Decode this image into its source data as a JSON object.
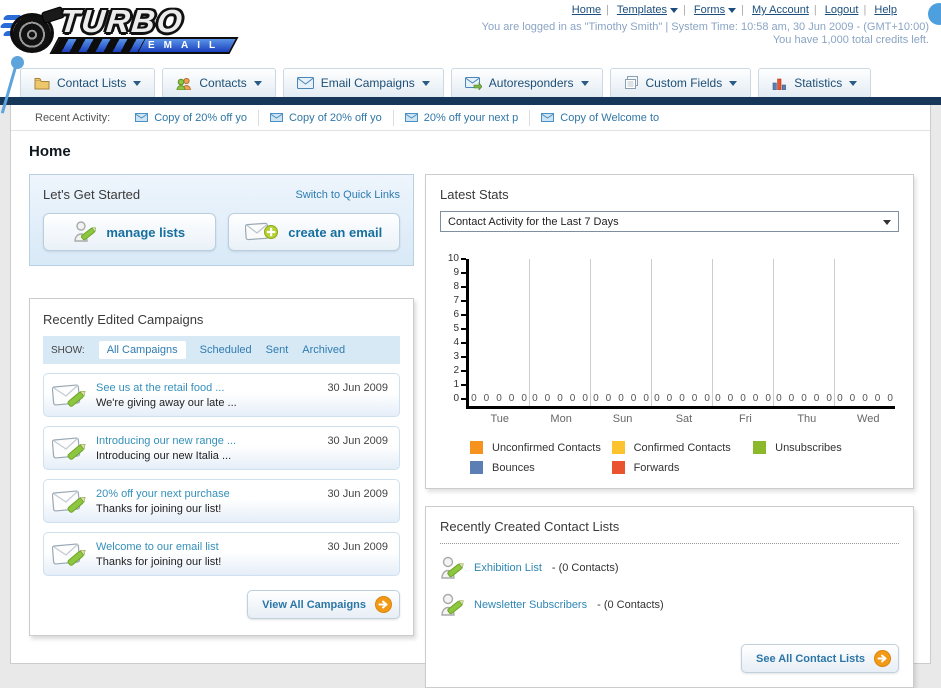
{
  "header": {
    "logo_line1": "TURBO",
    "logo_line2": "EMAIL",
    "nav": {
      "home": "Home",
      "templates": "Templates",
      "forms": "Forms",
      "my_account": "My Account",
      "logout": "Logout",
      "help": "Help"
    },
    "login_info": "You are logged in as \"Timothy Smith\" | System Time: 10:58 am, 30 Jun 2009 - (GMT+10:00)",
    "credits_info": "You have 1,000 total credits left."
  },
  "tabs": [
    {
      "label": "Contact Lists"
    },
    {
      "label": "Contacts"
    },
    {
      "label": "Email Campaigns"
    },
    {
      "label": "Autoresponders"
    },
    {
      "label": "Custom Fields"
    },
    {
      "label": "Statistics"
    }
  ],
  "recent_activity": {
    "label": "Recent Activity:",
    "items": [
      {
        "text": "Copy of 20% off yo"
      },
      {
        "text": "Copy of 20% off yo"
      },
      {
        "text": "20% off your next p"
      },
      {
        "text": "Copy of Welcome to"
      }
    ]
  },
  "home_title": "Home",
  "get_started": {
    "title": "Let's Get Started",
    "switch_link": "Switch to Quick Links",
    "manage_lists_label": "manage lists",
    "create_email_label": "create an email"
  },
  "campaigns_panel": {
    "title": "Recently Edited Campaigns",
    "show_label": "SHOW:",
    "filters": [
      {
        "label": "All Campaigns"
      },
      {
        "label": "Scheduled"
      },
      {
        "label": "Sent"
      },
      {
        "label": "Archived"
      }
    ],
    "items": [
      {
        "title": "See us at the retail food ...",
        "subtitle": "We're giving away our late ...",
        "date": "30 Jun 2009"
      },
      {
        "title": "Introducing our new range ...",
        "subtitle": "Introducing our new Italia ...",
        "date": "30 Jun 2009"
      },
      {
        "title": "20% off your next purchase",
        "subtitle": "Thanks for joining our list!",
        "date": "30 Jun 2009"
      },
      {
        "title": "Welcome to our email list",
        "subtitle": "Thanks for joining our list!",
        "date": "30 Jun 2009"
      }
    ],
    "view_all_label": "View All Campaigns"
  },
  "stats_panel": {
    "title": "Latest Stats",
    "dropdown_value": "Contact Activity for the Last 7 Days"
  },
  "chart_data": {
    "type": "bar",
    "categories": [
      "Tue",
      "Mon",
      "Sun",
      "Sat",
      "Fri",
      "Thu",
      "Wed"
    ],
    "series": [
      {
        "name": "Unconfirmed Contacts",
        "color": "#f6921e",
        "values": [
          0,
          0,
          0,
          0,
          0,
          0,
          0
        ]
      },
      {
        "name": "Confirmed Contacts",
        "color": "#fdc32f",
        "values": [
          0,
          0,
          0,
          0,
          0,
          0,
          0
        ]
      },
      {
        "name": "Unsubscribes",
        "color": "#8cb82b",
        "values": [
          0,
          0,
          0,
          0,
          0,
          0,
          0
        ]
      },
      {
        "name": "Bounces",
        "color": "#5b7fb4",
        "values": [
          0,
          0,
          0,
          0,
          0,
          0,
          0
        ]
      },
      {
        "name": "Forwards",
        "color": "#e9532d",
        "values": [
          0,
          0,
          0,
          0,
          0,
          0,
          0
        ]
      }
    ],
    "ylim": [
      0,
      10
    ],
    "yticks": [
      10,
      9,
      8,
      7,
      6,
      5,
      4,
      3,
      2,
      1,
      0
    ],
    "grid": "vertical",
    "legend_position": "bottom",
    "value_labels_shown": true
  },
  "contact_lists_panel": {
    "title": "Recently Created Contact Lists",
    "items": [
      {
        "name": "Exhibition List",
        "count": "- (0 Contacts)"
      },
      {
        "name": "Newsletter Subscribers",
        "count": "- (0 Contacts)"
      }
    ],
    "see_all_label": "See All Contact Lists"
  }
}
